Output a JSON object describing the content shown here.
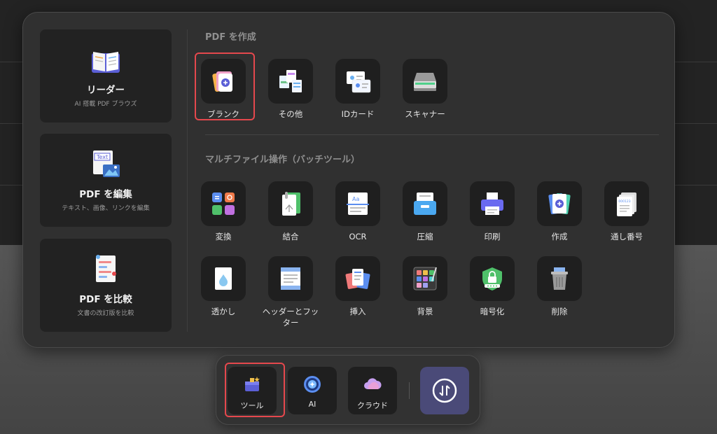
{
  "left_cards": [
    {
      "title": "リーダー",
      "subtitle": "AI 搭載 PDF ブラウズ",
      "icon": "book-icon"
    },
    {
      "title": "PDF を編集",
      "subtitle": "テキスト、画像、リンクを編集",
      "icon": "edit-text-icon",
      "icon_text": "Text"
    },
    {
      "title": "PDF を比較",
      "subtitle": "文書の改訂版を比較",
      "icon": "compare-document-icon"
    }
  ],
  "sections": {
    "create": {
      "title": "PDF を作成",
      "items": [
        {
          "label": "ブランク",
          "icon": "blank-document-icon",
          "highlighted": true
        },
        {
          "label": "その他",
          "icon": "other-documents-icon"
        },
        {
          "label": "IDカード",
          "icon": "id-card-icon"
        },
        {
          "label": "スキャナー",
          "icon": "scanner-icon"
        }
      ]
    },
    "batch": {
      "title": "マルチファイル操作（バッチツール）",
      "items": [
        {
          "label": "変換",
          "icon": "convert-icon"
        },
        {
          "label": "結合",
          "icon": "combine-icon"
        },
        {
          "label": "OCR",
          "icon": "ocr-icon",
          "icon_text": "Aa"
        },
        {
          "label": "圧縮",
          "icon": "compress-icon"
        },
        {
          "label": "印刷",
          "icon": "print-icon"
        },
        {
          "label": "作成",
          "icon": "create-icon"
        },
        {
          "label": "通し番号",
          "icon": "bates-number-icon",
          "icon_text": "000123"
        },
        {
          "label": "透かし",
          "icon": "watermark-icon"
        },
        {
          "label": "ヘッダーとフッター",
          "icon": "header-footer-icon"
        },
        {
          "label": "挿入",
          "icon": "insert-icon"
        },
        {
          "label": "背景",
          "icon": "background-icon"
        },
        {
          "label": "暗号化",
          "icon": "encrypt-icon"
        },
        {
          "label": "削除",
          "icon": "delete-icon"
        }
      ]
    }
  },
  "dock": {
    "items": [
      {
        "label": "ツール",
        "icon": "toolbox-icon",
        "highlighted": true
      },
      {
        "label": "AI",
        "icon": "ai-icon"
      },
      {
        "label": "クラウド",
        "icon": "cloud-icon"
      }
    ],
    "primary_icon": "sync-icon"
  },
  "colors": {
    "highlight": "#e5484d",
    "accent": "#4a4a78"
  }
}
